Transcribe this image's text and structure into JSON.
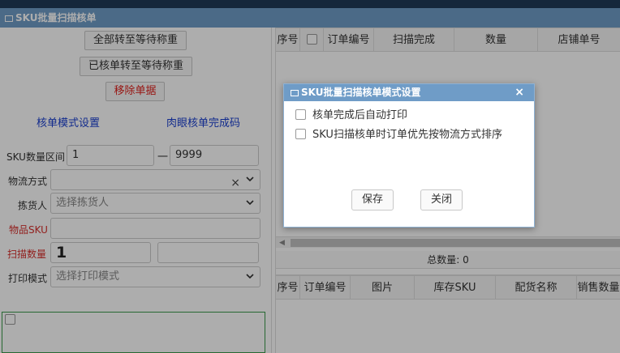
{
  "window": {
    "title": "SKU批量扫描核单"
  },
  "left": {
    "btn_all_to_weigh": "全部转至等待称重",
    "btn_checked_to_weigh": "已核单转至等待称重",
    "btn_remove": "移除单据",
    "link_mode_setting": "核单模式设置",
    "link_eye_check": "肉眼核单完成码",
    "sku_range_label": "SKU数量区间",
    "sku_range_from": "1",
    "sku_range_dash": "一",
    "sku_range_to": "9999",
    "logistics_label": "物流方式",
    "logistics_value": "",
    "picker_label": "拣货人",
    "picker_placeholder": "选择拣货人",
    "item_sku_label": "物品SKU",
    "item_sku_value": "",
    "scan_qty_label": "扫描数量",
    "scan_qty_value": "1",
    "scan_qty_extra": "",
    "print_mode_label": "打印模式",
    "print_mode_placeholder": "选择打印模式"
  },
  "right": {
    "top_columns": [
      "序号",
      "",
      "订单编号",
      "扫描完成",
      "数量",
      "店铺单号"
    ],
    "total_label": "总数量: 0",
    "bottom_columns": [
      "序号",
      "订单编号",
      "图片",
      "库存SKU",
      "配货名称",
      "销售数量"
    ]
  },
  "dialog": {
    "title": "SKU批量扫描核单模式设置",
    "close_glyph": "×",
    "option_auto_print": "核单完成后自动打印",
    "option_sort_logistics": "SKU扫描核单时订单优先按物流方式排序",
    "save_label": "保存",
    "close_label": "关闭"
  },
  "colors": {
    "accent": "#6f9cc7",
    "danger": "#e0211d",
    "link": "#1a3fd0"
  }
}
